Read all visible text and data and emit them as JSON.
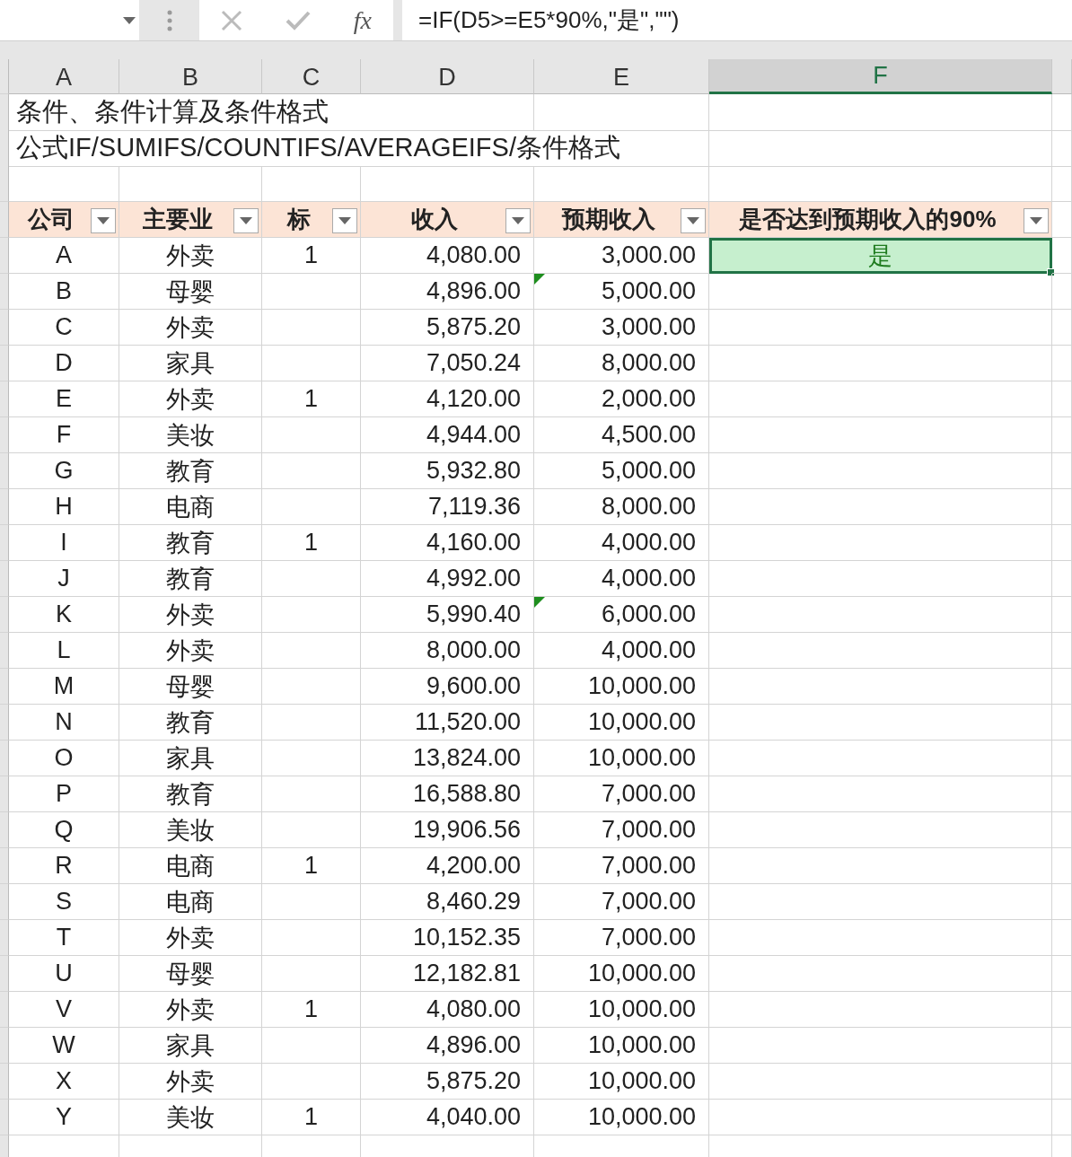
{
  "formula_bar": {
    "fx_label": "fx",
    "formula": "=IF(D5>=E5*90%,\"是\",\"\")"
  },
  "columns": [
    {
      "label": "A",
      "selected": false
    },
    {
      "label": "B",
      "selected": false
    },
    {
      "label": "C",
      "selected": false
    },
    {
      "label": "D",
      "selected": false
    },
    {
      "label": "E",
      "selected": false
    },
    {
      "label": "F",
      "selected": true
    }
  ],
  "title_rows": [
    "条件、条件计算及条件格式",
    "公式IF/SUMIFS/COUNTIFS/AVERAGEIFS/条件格式"
  ],
  "table_headers": [
    "公司",
    "主要业",
    "标",
    "收入",
    "预期收入",
    "是否达到预期收入的90%"
  ],
  "rows": [
    {
      "company": "A",
      "business": "外卖",
      "mark": "1",
      "income": "4,080.00",
      "expected": "3,000.00",
      "result": "是",
      "selected": true,
      "flagged": false
    },
    {
      "company": "B",
      "business": "母婴",
      "income": "4,896.00",
      "expected": "5,000.00",
      "selected": false,
      "flagged": true
    },
    {
      "company": "C",
      "business": "外卖",
      "income": "5,875.20",
      "expected": "3,000.00",
      "selected": false,
      "flagged": false
    },
    {
      "company": "D",
      "business": "家具",
      "income": "7,050.24",
      "expected": "8,000.00",
      "selected": false,
      "flagged": false
    },
    {
      "company": "E",
      "business": "外卖",
      "mark": "1",
      "income": "4,120.00",
      "expected": "2,000.00",
      "selected": false,
      "flagged": false
    },
    {
      "company": "F",
      "business": "美妆",
      "income": "4,944.00",
      "expected": "4,500.00",
      "selected": false,
      "flagged": false
    },
    {
      "company": "G",
      "business": "教育",
      "income": "5,932.80",
      "expected": "5,000.00",
      "selected": false,
      "flagged": false
    },
    {
      "company": "H",
      "business": "电商",
      "income": "7,119.36",
      "expected": "8,000.00",
      "selected": false,
      "flagged": false
    },
    {
      "company": "I",
      "business": "教育",
      "mark": "1",
      "income": "4,160.00",
      "expected": "4,000.00",
      "selected": false,
      "flagged": false
    },
    {
      "company": "J",
      "business": "教育",
      "income": "4,992.00",
      "expected": "4,000.00",
      "selected": false,
      "flagged": false
    },
    {
      "company": "K",
      "business": "外卖",
      "income": "5,990.40",
      "expected": "6,000.00",
      "selected": false,
      "flagged": true
    },
    {
      "company": "L",
      "business": "外卖",
      "income": "8,000.00",
      "expected": "4,000.00",
      "selected": false,
      "flagged": false
    },
    {
      "company": "M",
      "business": "母婴",
      "income": "9,600.00",
      "expected": "10,000.00",
      "selected": false,
      "flagged": false
    },
    {
      "company": "N",
      "business": "教育",
      "income": "11,520.00",
      "expected": "10,000.00",
      "selected": false,
      "flagged": false
    },
    {
      "company": "O",
      "business": "家具",
      "income": "13,824.00",
      "expected": "10,000.00",
      "selected": false,
      "flagged": false
    },
    {
      "company": "P",
      "business": "教育",
      "income": "16,588.80",
      "expected": "7,000.00",
      "selected": false,
      "flagged": false
    },
    {
      "company": "Q",
      "business": "美妆",
      "income": "19,906.56",
      "expected": "7,000.00",
      "selected": false,
      "flagged": false
    },
    {
      "company": "R",
      "business": "电商",
      "mark": "1",
      "income": "4,200.00",
      "expected": "7,000.00",
      "selected": false,
      "flagged": false
    },
    {
      "company": "S",
      "business": "电商",
      "income": "8,460.29",
      "expected": "7,000.00",
      "selected": false,
      "flagged": false
    },
    {
      "company": "T",
      "business": "外卖",
      "income": "10,152.35",
      "expected": "7,000.00",
      "selected": false,
      "flagged": false
    },
    {
      "company": "U",
      "business": "母婴",
      "income": "12,182.81",
      "expected": "10,000.00",
      "selected": false,
      "flagged": false
    },
    {
      "company": "V",
      "business": "外卖",
      "mark": "1",
      "income": "4,080.00",
      "expected": "10,000.00",
      "selected": false,
      "flagged": false
    },
    {
      "company": "W",
      "business": "家具",
      "income": "4,896.00",
      "expected": "10,000.00",
      "selected": false,
      "flagged": false
    },
    {
      "company": "X",
      "business": "外卖",
      "income": "5,875.20",
      "expected": "10,000.00",
      "selected": false,
      "flagged": false
    },
    {
      "company": "Y",
      "business": "美妆",
      "mark": "1",
      "income": "4,040.00",
      "expected": "10,000.00",
      "selected": false,
      "flagged": false
    }
  ]
}
